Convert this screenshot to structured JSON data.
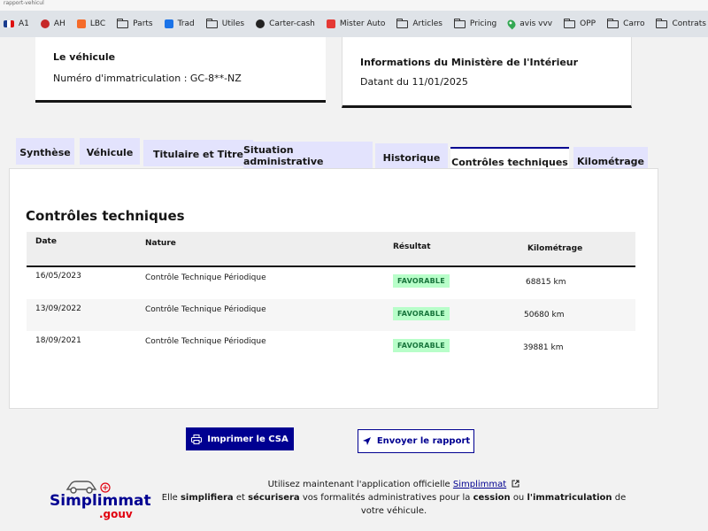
{
  "browser": {
    "top_strip": "rapport-vehicul",
    "bookmarks": [
      {
        "label": "A1",
        "icon": "flag-icon"
      },
      {
        "label": "AH",
        "icon": "badge-icon"
      },
      {
        "label": "LBC",
        "icon": "lbc-icon"
      },
      {
        "label": "Parts",
        "icon": "folder-icon"
      },
      {
        "label": "Trad",
        "icon": "translate-icon"
      },
      {
        "label": "Utiles",
        "icon": "folder-icon"
      },
      {
        "label": "Carter-cash",
        "icon": "carter-icon"
      },
      {
        "label": "Mister Auto",
        "icon": "misterauto-icon"
      },
      {
        "label": "Articles",
        "icon": "folder-icon"
      },
      {
        "label": "Pricing",
        "icon": "folder-icon"
      },
      {
        "label": "avis vvv",
        "icon": "map-pin-icon"
      },
      {
        "label": "OPP",
        "icon": "folder-icon"
      },
      {
        "label": "Carro",
        "icon": "folder-icon"
      },
      {
        "label": "Contrats Distance",
        "icon": "folder-icon"
      }
    ]
  },
  "vehicle_card": {
    "title": "Le véhicule",
    "plate_label": "Numéro d'immatriculation : GC-8**-NZ"
  },
  "ministry_card": {
    "title": "Informations du Ministère de l'Intérieur",
    "date_text": "Datant du 11/01/2025"
  },
  "tabs": [
    {
      "label": "Synthèse",
      "active": false
    },
    {
      "label": "Véhicule",
      "active": false
    },
    {
      "label": "Titulaire et Titre",
      "active": false
    },
    {
      "label": "Situation administrative",
      "active": false
    },
    {
      "label": "Historique",
      "active": false
    },
    {
      "label": "Contrôles techniques",
      "active": true
    },
    {
      "label": "Kilométrage",
      "active": false
    }
  ],
  "inspections": {
    "title": "Contrôles techniques",
    "columns": [
      "Date",
      "Nature",
      "Résultat",
      "Kilométrage"
    ],
    "rows": [
      {
        "date": "16/05/2023",
        "nature": "Contrôle Technique Périodique",
        "result": "FAVORABLE",
        "mileage": "68815 km"
      },
      {
        "date": "13/09/2022",
        "nature": "Contrôle Technique Périodique",
        "result": "FAVORABLE",
        "mileage": "50680 km"
      },
      {
        "date": "18/09/2021",
        "nature": "Contrôle Technique Périodique",
        "result": "FAVORABLE",
        "mileage": "39881 km"
      }
    ]
  },
  "actions": {
    "print_label": "Imprimer le CSA",
    "send_label": "Envoyer le rapport"
  },
  "footer": {
    "logo_word": "Simplimmat",
    "logo_sub": ".gouv",
    "line1_prefix": "Utilisez maintenant l'application officielle",
    "app_link": "Simplimmat",
    "line2_a": "Elle",
    "line2_b": "simplifiera",
    "line2_c": "et",
    "line2_d": "sécurisera",
    "line2_e": "vos formalités administratives pour la",
    "line2_f": "cession",
    "line2_g": "ou",
    "line2_h": "l'immatriculation",
    "line2_i": "de",
    "line3": "votre véhicule."
  },
  "colors": {
    "primary": "#000091",
    "tab_bg": "#e3e3fd",
    "success_bg": "#b8fec9",
    "success_text": "#18753c",
    "logo_red": "#e1000f"
  }
}
